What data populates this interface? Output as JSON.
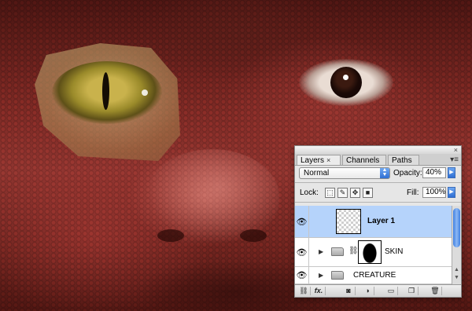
{
  "panel": {
    "tabs": [
      {
        "label": "Layers",
        "close": "×"
      },
      {
        "label": "Channels"
      },
      {
        "label": "Paths"
      }
    ],
    "close_glyph": "×",
    "menu_glyph": "▾≡",
    "blend_mode": "Normal",
    "opacity_label": "Opacity:",
    "opacity_value": "40%",
    "lock_label": "Lock:",
    "fill_label": "Fill:",
    "fill_value": "100%",
    "layers": [
      {
        "name": "Layer 1",
        "selected": true
      },
      {
        "name": "SKIN",
        "selected": false
      },
      {
        "name": "CREATURE",
        "selected": false
      }
    ],
    "bottom_fx_label": "fx."
  },
  "colors": {
    "selection": "#b5d3fb",
    "accent_blue": "#2f6fd3"
  }
}
